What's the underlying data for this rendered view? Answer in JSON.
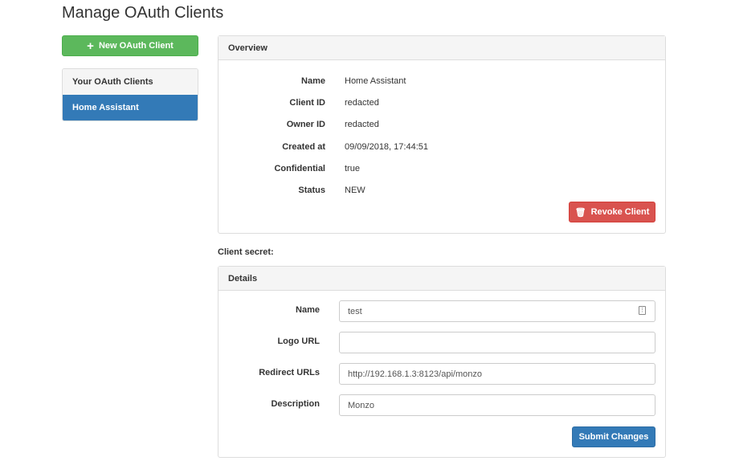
{
  "page_title": "Manage OAuth Clients",
  "new_client_label": "New OAuth Client",
  "sidebar": {
    "header": "Your OAuth Clients",
    "items": [
      {
        "label": "Home Assistant",
        "active": true
      }
    ]
  },
  "overview": {
    "title": "Overview",
    "rows": [
      {
        "label": "Name",
        "value": "Home Assistant"
      },
      {
        "label": "Client ID",
        "value": "redacted"
      },
      {
        "label": "Owner ID",
        "value": "redacted"
      },
      {
        "label": "Created at",
        "value": "09/09/2018, 17:44:51"
      },
      {
        "label": "Confidential",
        "value": "true"
      },
      {
        "label": "Status",
        "value": "NEW"
      }
    ],
    "revoke_label": "Revoke Client"
  },
  "client_secret_label": "Client secret:",
  "details": {
    "title": "Details",
    "fields": [
      {
        "label": "Name",
        "value": "test"
      },
      {
        "label": "Logo URL",
        "value": ""
      },
      {
        "label": "Redirect URLs",
        "value": "http://192.168.1.3:8123/api/monzo"
      },
      {
        "label": "Description",
        "value": "Monzo"
      }
    ],
    "submit_label": "Submit Changes"
  },
  "colors": {
    "success": "#5cb85c",
    "primary": "#337ab7",
    "danger": "#d9534f"
  }
}
